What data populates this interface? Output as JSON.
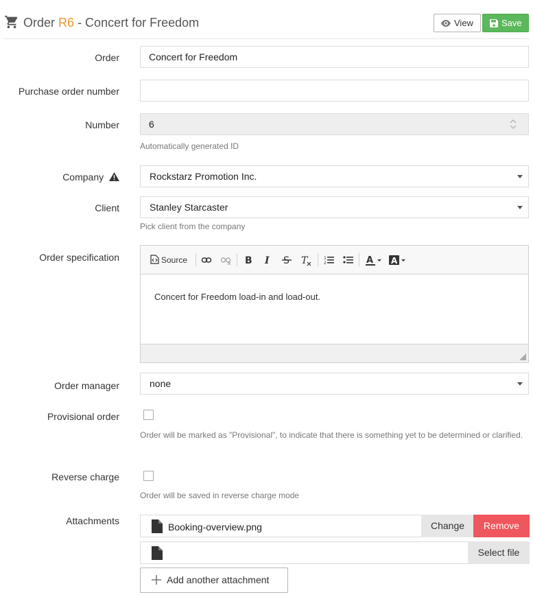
{
  "header": {
    "title_prefix": "Order",
    "order_code": "R6",
    "title_suffix": "- Concert for Freedom",
    "view_label": "View",
    "save_label": "Save"
  },
  "fields": {
    "order": {
      "label": "Order",
      "value": "Concert for Freedom"
    },
    "po_number": {
      "label": "Purchase order number",
      "value": ""
    },
    "number": {
      "label": "Number",
      "value": "6",
      "help": "Automatically generated ID"
    },
    "company": {
      "label": "Company",
      "value": "Rockstarz Promotion Inc."
    },
    "client": {
      "label": "Client",
      "value": "Stanley Starcaster",
      "help": "Pick client from the company"
    },
    "specification": {
      "label": "Order specification",
      "body": "Concert for Freedom load-in and load-out."
    },
    "manager": {
      "label": "Order manager",
      "value": "none"
    },
    "provisional": {
      "label": "Provisional order",
      "checked": false,
      "help": "Order will be marked as \"Provisional\", to indicate that there is something yet to be determined or clarified."
    },
    "reverse_charge": {
      "label": "Reverse charge",
      "checked": false,
      "help": "Order will be saved in reverse charge mode"
    }
  },
  "editor": {
    "toolbar": {
      "source_label": "Source",
      "buttons": [
        "link-icon",
        "unlink-icon",
        "bold-icon",
        "italic-icon",
        "strikethrough-icon",
        "remove-format-icon",
        "numbered-list-icon",
        "bulleted-list-icon",
        "text-color-icon",
        "background-color-icon"
      ]
    }
  },
  "attachments": {
    "label": "Attachments",
    "items": [
      {
        "file_name": "Booking-overview.png",
        "change_label": "Change",
        "remove_label": "Remove"
      }
    ],
    "empty": {
      "select_label": "Select file"
    },
    "add_label": "Add another attachment"
  },
  "colors": {
    "accent_code": "#e8962b",
    "save": "#5cb85c",
    "remove": "#f0565d"
  }
}
